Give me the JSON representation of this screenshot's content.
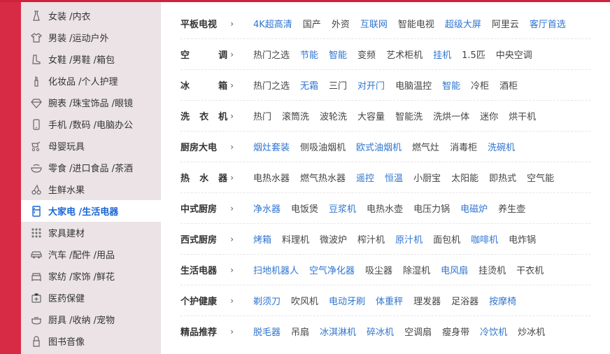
{
  "sidebar": {
    "items": [
      {
        "label": "女装 /内衣",
        "icon": "dress-icon"
      },
      {
        "label": "男装 /运动户外",
        "icon": "shirt-icon"
      },
      {
        "label": "女鞋 /男鞋 /箱包",
        "icon": "boot-icon"
      },
      {
        "label": "化妆品 /个人护理",
        "icon": "lipstick-icon"
      },
      {
        "label": "腕表 /珠宝饰品 /眼镜",
        "icon": "diamond-icon"
      },
      {
        "label": "手机 /数码 /电脑办公",
        "icon": "phone-icon"
      },
      {
        "label": "母婴玩具",
        "icon": "stroller-icon"
      },
      {
        "label": "零食 /进口食品 /茶酒",
        "icon": "bowl-icon"
      },
      {
        "label": "生鲜水果",
        "icon": "cherry-icon"
      },
      {
        "label": "大家电 /生活电器",
        "icon": "fridge-icon"
      },
      {
        "label": "家具建材",
        "icon": "grid-icon"
      },
      {
        "label": "汽车 /配件 /用品",
        "icon": "car-icon"
      },
      {
        "label": "家纺 /家饰 /鲜花",
        "icon": "sofa-icon"
      },
      {
        "label": "医药保健",
        "icon": "medicine-icon"
      },
      {
        "label": "厨具 /收纳 /宠物",
        "icon": "pot-icon"
      },
      {
        "label": "图书音像",
        "icon": "book-icon"
      }
    ],
    "active_index": 9
  },
  "colors": {
    "accent_red": "#d72b45",
    "link_blue": "#2f74d0",
    "sidebar_bg": "#ebe3e6"
  },
  "rows": [
    {
      "title": "平板电视",
      "links": [
        {
          "t": "4K超高清",
          "hl": true
        },
        {
          "t": "国产",
          "hl": false
        },
        {
          "t": "外资",
          "hl": false
        },
        {
          "t": "互联网",
          "hl": true
        },
        {
          "t": "智能电视",
          "hl": false
        },
        {
          "t": "超级大屏",
          "hl": true
        },
        {
          "t": "阿里云",
          "hl": false
        },
        {
          "t": "客厅首选",
          "hl": true
        }
      ]
    },
    {
      "title": "空　调",
      "links": [
        {
          "t": "热门之选",
          "hl": false
        },
        {
          "t": "节能",
          "hl": true
        },
        {
          "t": "智能",
          "hl": true
        },
        {
          "t": "变频",
          "hl": false
        },
        {
          "t": "艺术柜机",
          "hl": false
        },
        {
          "t": "挂机",
          "hl": true
        },
        {
          "t": "1.5匹",
          "hl": false
        },
        {
          "t": "中央空调",
          "hl": false
        }
      ]
    },
    {
      "title": "冰　箱",
      "links": [
        {
          "t": "热门之选",
          "hl": false
        },
        {
          "t": "无霜",
          "hl": true
        },
        {
          "t": "三门",
          "hl": false
        },
        {
          "t": "对开门",
          "hl": true
        },
        {
          "t": "电脑温控",
          "hl": false
        },
        {
          "t": "智能",
          "hl": true
        },
        {
          "t": "冷柜",
          "hl": false
        },
        {
          "t": "酒柜",
          "hl": false
        }
      ]
    },
    {
      "title": "洗衣机",
      "links": [
        {
          "t": "热门",
          "hl": false
        },
        {
          "t": "滚筒洗",
          "hl": false
        },
        {
          "t": "波轮洗",
          "hl": false
        },
        {
          "t": "大容量",
          "hl": false
        },
        {
          "t": "智能洗",
          "hl": false
        },
        {
          "t": "洗烘一体",
          "hl": false
        },
        {
          "t": "迷你",
          "hl": false
        },
        {
          "t": "烘干机",
          "hl": false
        }
      ]
    },
    {
      "title": "厨房大电",
      "links": [
        {
          "t": "烟灶套装",
          "hl": true
        },
        {
          "t": "侧吸油烟机",
          "hl": false
        },
        {
          "t": "欧式油烟机",
          "hl": true
        },
        {
          "t": "燃气灶",
          "hl": false
        },
        {
          "t": "消毒柜",
          "hl": false
        },
        {
          "t": "洗碗机",
          "hl": true
        }
      ]
    },
    {
      "title": "热水器",
      "links": [
        {
          "t": "电热水器",
          "hl": false
        },
        {
          "t": "燃气热水器",
          "hl": false
        },
        {
          "t": "遥控",
          "hl": true
        },
        {
          "t": "恒温",
          "hl": true
        },
        {
          "t": "小厨宝",
          "hl": false
        },
        {
          "t": "太阳能",
          "hl": false
        },
        {
          "t": "即热式",
          "hl": false
        },
        {
          "t": "空气能",
          "hl": false
        }
      ]
    },
    {
      "title": "中式厨房",
      "links": [
        {
          "t": "净水器",
          "hl": true
        },
        {
          "t": "电饭煲",
          "hl": false
        },
        {
          "t": "豆浆机",
          "hl": true
        },
        {
          "t": "电热水壶",
          "hl": false
        },
        {
          "t": "电压力锅",
          "hl": false
        },
        {
          "t": "电磁炉",
          "hl": true
        },
        {
          "t": "养生壶",
          "hl": false
        }
      ]
    },
    {
      "title": "西式厨房",
      "links": [
        {
          "t": "烤箱",
          "hl": true
        },
        {
          "t": "料理机",
          "hl": false
        },
        {
          "t": "微波炉",
          "hl": false
        },
        {
          "t": "榨汁机",
          "hl": false
        },
        {
          "t": "原汁机",
          "hl": true
        },
        {
          "t": "面包机",
          "hl": false
        },
        {
          "t": "咖啡机",
          "hl": true
        },
        {
          "t": "电炸锅",
          "hl": false
        }
      ]
    },
    {
      "title": "生活电器",
      "links": [
        {
          "t": "扫地机器人",
          "hl": true
        },
        {
          "t": "空气净化器",
          "hl": true
        },
        {
          "t": "吸尘器",
          "hl": false
        },
        {
          "t": "除湿机",
          "hl": false
        },
        {
          "t": "电风扇",
          "hl": true
        },
        {
          "t": "挂烫机",
          "hl": false
        },
        {
          "t": "干衣机",
          "hl": false
        }
      ]
    },
    {
      "title": "个护健康",
      "links": [
        {
          "t": "剃须刀",
          "hl": true
        },
        {
          "t": "吹风机",
          "hl": false
        },
        {
          "t": "电动牙刷",
          "hl": true
        },
        {
          "t": "体重秤",
          "hl": true
        },
        {
          "t": "理发器",
          "hl": false
        },
        {
          "t": "足浴器",
          "hl": false
        },
        {
          "t": "按摩椅",
          "hl": true
        }
      ]
    },
    {
      "title": "精品推荐",
      "links": [
        {
          "t": "脱毛器",
          "hl": true
        },
        {
          "t": "吊扇",
          "hl": false
        },
        {
          "t": "冰淇淋机",
          "hl": true
        },
        {
          "t": "碎冰机",
          "hl": true
        },
        {
          "t": "空调扇",
          "hl": false
        },
        {
          "t": "瘦身带",
          "hl": false
        },
        {
          "t": "冷饮机",
          "hl": true
        },
        {
          "t": "炒冰机",
          "hl": false
        }
      ]
    }
  ],
  "arrow_glyph": "›"
}
